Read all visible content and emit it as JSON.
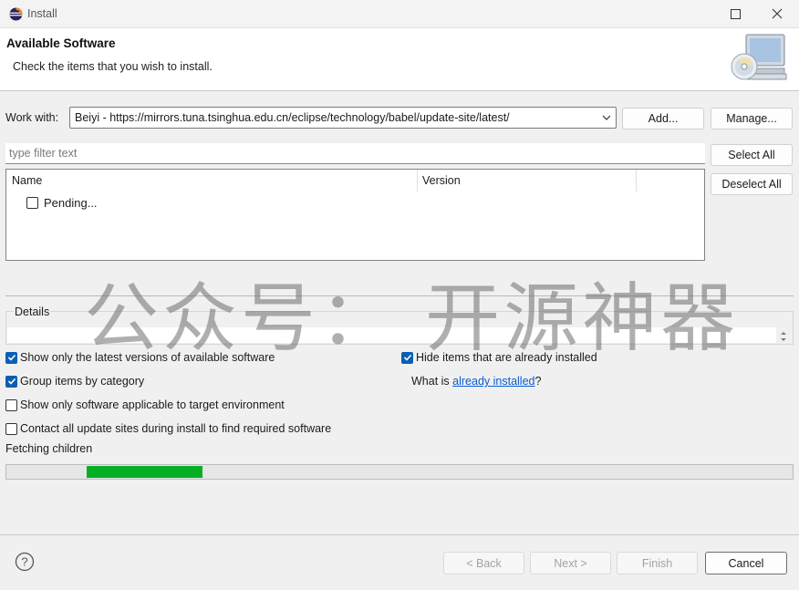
{
  "window": {
    "title": "Install"
  },
  "header": {
    "title": "Available Software",
    "description": "Check the items that you wish to install."
  },
  "work_with": {
    "label": "Work with:",
    "value": "Beiyi - https://mirrors.tuna.tsinghua.edu.cn/eclipse/technology/babel/update-site/latest/",
    "add_label": "Add...",
    "manage_label": "Manage..."
  },
  "filter": {
    "placeholder": "type filter text"
  },
  "side_buttons": {
    "select_all": "Select All",
    "deselect_all": "Deselect All"
  },
  "tree": {
    "columns": [
      "Name",
      "Version"
    ],
    "rows": [
      {
        "name": "Pending...",
        "checked": false
      }
    ]
  },
  "details": {
    "label": "Details"
  },
  "options": {
    "show_latest": {
      "label": "Show only the latest versions of available software",
      "checked": true
    },
    "group_by_category": {
      "label": "Group items by category",
      "checked": true
    },
    "show_applicable": {
      "label": "Show only software applicable to target environment",
      "checked": false
    },
    "contact_sites": {
      "label": "Contact all update sites during install to find required software",
      "checked": false
    },
    "hide_installed": {
      "label": "Hide items that are already installed",
      "checked": true
    },
    "what_is_prefix": "What is ",
    "already_installed_link": "already installed",
    "what_is_suffix": "?"
  },
  "status": {
    "text": "Fetching children",
    "progress_fill_start": 0.102,
    "progress_fill_end": 0.249
  },
  "footer": {
    "back": "< Back",
    "next": "Next >",
    "finish": "Finish",
    "cancel": "Cancel"
  },
  "watermark": "公众号：  开源神器",
  "colors": {
    "accent": "#0a5fb4",
    "progress": "#06b025",
    "link": "#0b5bd3"
  }
}
